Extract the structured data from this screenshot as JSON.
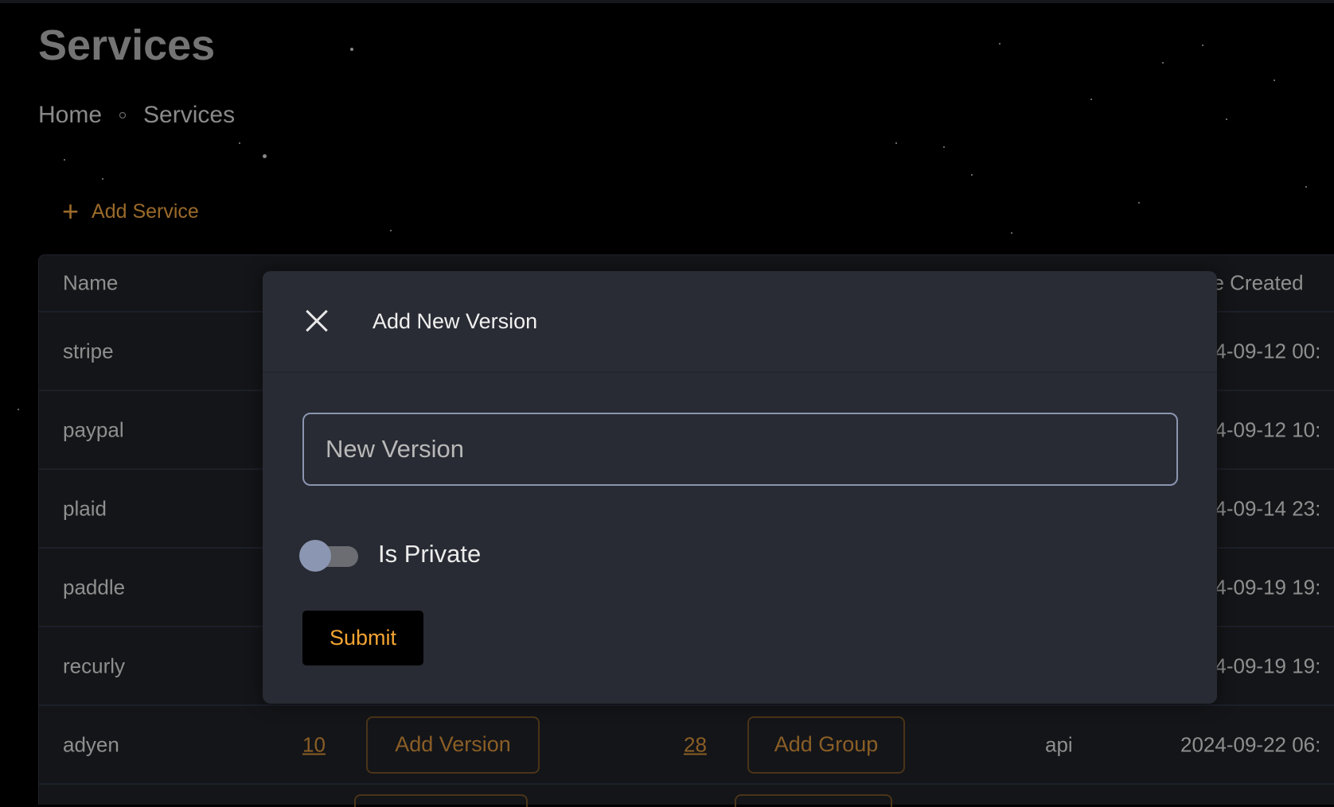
{
  "page": {
    "title": "Services"
  },
  "breadcrumb": [
    {
      "label": "Home"
    },
    {
      "label": "Services"
    }
  ],
  "toolbar": {
    "add_service_label": "Add Service",
    "add_icon": "plus-icon"
  },
  "table": {
    "headers": {
      "name": "Name",
      "date_created": "Date Created"
    },
    "rows": [
      {
        "name": "stripe",
        "date": "2024-09-12 00:"
      },
      {
        "name": "paypal",
        "date": "2024-09-12 10:"
      },
      {
        "name": "plaid",
        "date": "2024-09-14 23:"
      },
      {
        "name": "paddle",
        "date": "2024-09-19 19:"
      },
      {
        "name": "recurly",
        "date": "2024-09-19 19:"
      },
      {
        "name": "adyen",
        "versions": "10",
        "add_version": "Add Version",
        "groups": "28",
        "add_group": "Add Group",
        "type": "api",
        "date": "2024-09-22 06:"
      }
    ]
  },
  "modal": {
    "title": "Add New Version",
    "close_icon": "close-icon",
    "input_placeholder": "New Version",
    "input_value": "",
    "toggle_label": "Is Private",
    "toggle_on": false,
    "submit_label": "Submit"
  },
  "colors": {
    "accent": "#f3a433",
    "muted_accent": "#8a5e26",
    "background": "#000000",
    "modal": "#282b33"
  }
}
